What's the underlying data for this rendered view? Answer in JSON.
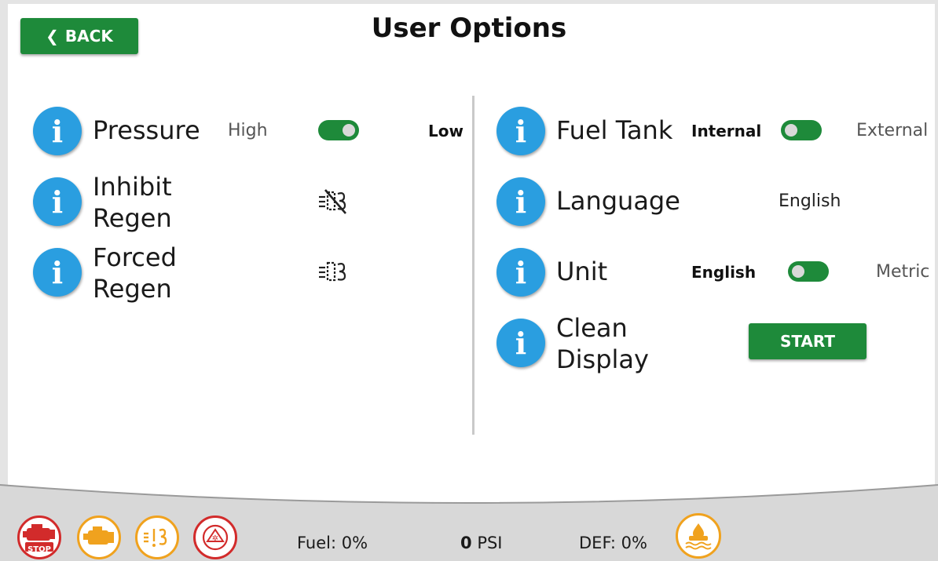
{
  "header": {
    "back_label": "BACK",
    "title": "User Options"
  },
  "left": {
    "pressure": {
      "label": "Pressure",
      "option_a": "High",
      "option_b": "Low",
      "toggle_state": "on"
    },
    "inhibit_regen": {
      "label_line1": "Inhibit",
      "label_line2": "Regen",
      "icon": "inhibit-regen-icon"
    },
    "forced_regen": {
      "label_line1": "Forced",
      "label_line2": "Regen",
      "icon": "forced-regen-icon"
    }
  },
  "right": {
    "fuel_tank": {
      "label": "Fuel Tank",
      "option_a": "Internal",
      "option_b": "External",
      "toggle_state": "off"
    },
    "language": {
      "label": "Language",
      "value": "English"
    },
    "unit": {
      "label": "Unit",
      "option_a": "English",
      "option_b": "Metric",
      "toggle_state": "off"
    },
    "clean_display": {
      "label_line1": "Clean",
      "label_line2": "Display",
      "start_label": "START"
    }
  },
  "status": {
    "fuel": "Fuel: 0%",
    "pressure_value": "0",
    "pressure_unit": "PSI",
    "def": "DEF: 0%",
    "stop_label": "STOP"
  },
  "colors": {
    "accent_green": "#1e8a3a",
    "info_blue": "#2a9ee0",
    "warning_orange": "#f0a21e",
    "alarm_red": "#d22b2b"
  }
}
